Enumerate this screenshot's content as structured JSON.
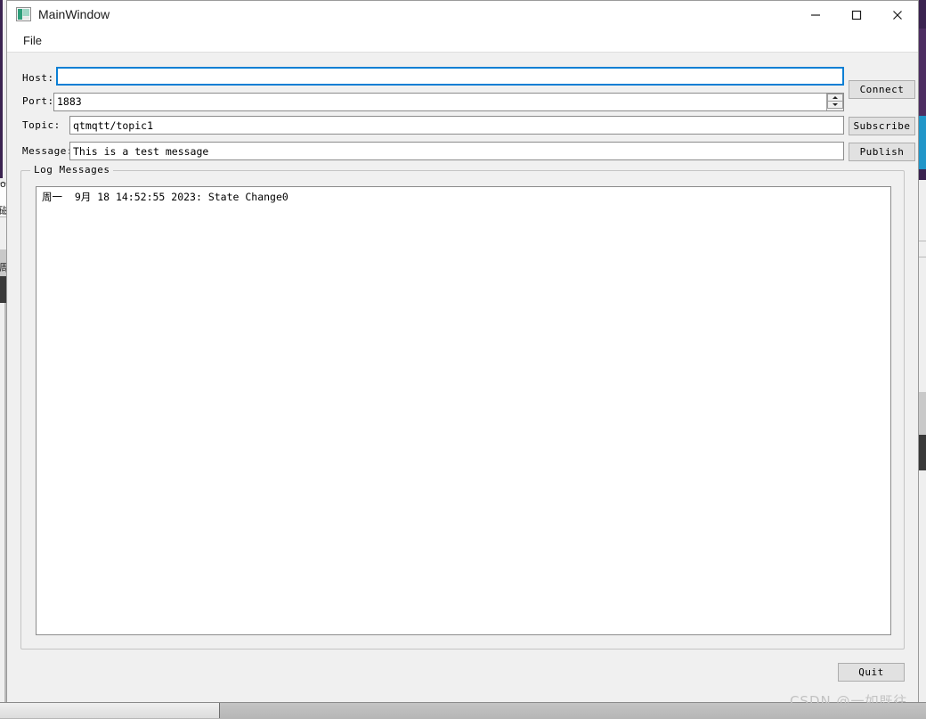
{
  "window": {
    "title": "MainWindow",
    "icon": "window-image-icon",
    "controls": {
      "minimize": "minimize-icon",
      "maximize": "maximize-icon",
      "close": "close-icon"
    }
  },
  "menubar": {
    "items": [
      {
        "label": "File"
      }
    ]
  },
  "form": {
    "host": {
      "label": "Host:",
      "value": "",
      "placeholder": "",
      "focused": true
    },
    "port": {
      "label": "Port:",
      "value": "1883",
      "spinner": {
        "up": "spin-up-icon",
        "down": "spin-down-icon"
      }
    },
    "topic": {
      "label": "Topic:",
      "value": "qtmqtt/topic1",
      "placeholder": ""
    },
    "message": {
      "label": "Message:",
      "value": "This is a test message",
      "placeholder": ""
    }
  },
  "buttons": {
    "connect": "Connect",
    "subscribe": "Subscribe",
    "publish": "Publish",
    "quit": "Quit"
  },
  "log": {
    "group_title": "Log Messages",
    "lines": [
      "周一  9月 18 14:52:55 2023: State Change0"
    ],
    "text": "周一  9月 18 14:52:55 2023: State Change0"
  },
  "watermark": {
    "text": "CSDN @一如既往_"
  },
  "background": {
    "fragment_top": "ot",
    "fragment_mid": "磁",
    "fragment_low": "周"
  },
  "colors": {
    "window_bg": "#f0f0f0",
    "titlebar_bg": "#ffffff",
    "field_bg": "#ffffff",
    "field_border": "#8c8c8c",
    "focus_border": "#0a7fd4",
    "button_bg": "#e1e1e1",
    "button_border": "#adadad",
    "desktop_purple": "#4d2e62",
    "desktop_blue": "#2196c9",
    "watermark": "#c2c2c2"
  }
}
